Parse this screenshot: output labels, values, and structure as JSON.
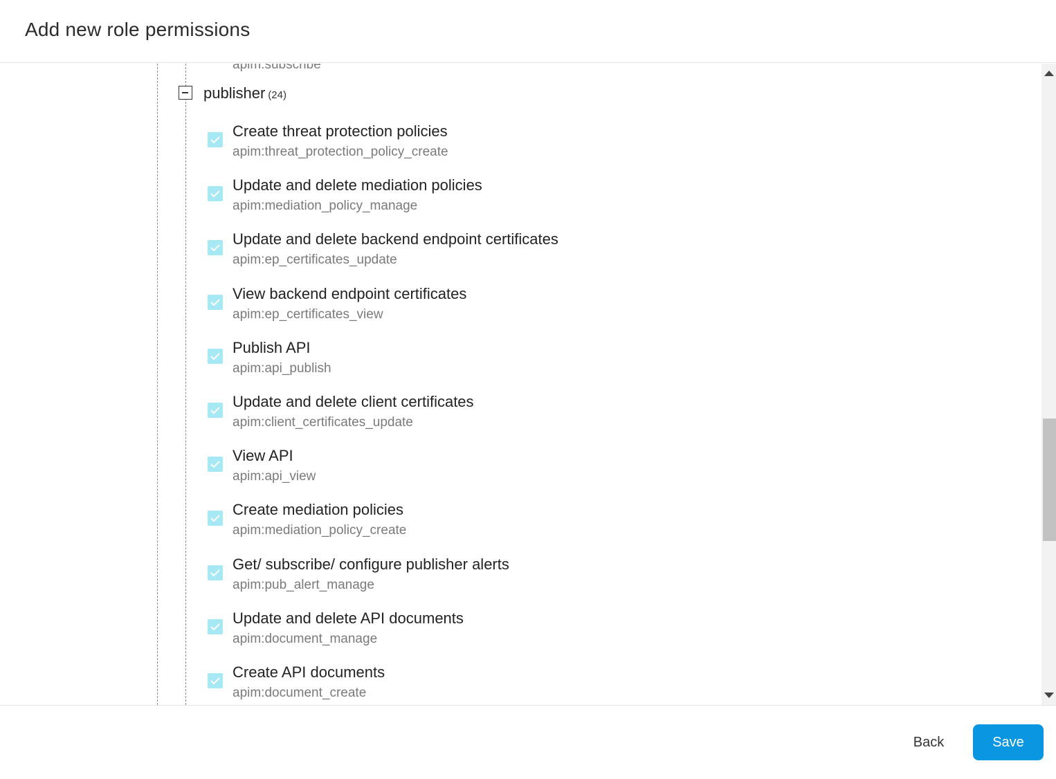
{
  "dialog": {
    "title": "Add new role permissions"
  },
  "tree": {
    "previous_item_code": "apim:subscribe",
    "group": {
      "name": "publisher",
      "count": "(24)",
      "expanded": true
    },
    "permissions": [
      {
        "label": "Create threat protection policies",
        "code": "apim:threat_protection_policy_create",
        "checked": true
      },
      {
        "label": "Update and delete mediation policies",
        "code": "apim:mediation_policy_manage",
        "checked": true
      },
      {
        "label": "Update and delete backend endpoint certificates",
        "code": "apim:ep_certificates_update",
        "checked": true
      },
      {
        "label": "View backend endpoint certificates",
        "code": "apim:ep_certificates_view",
        "checked": true
      },
      {
        "label": "Publish API",
        "code": "apim:api_publish",
        "checked": true
      },
      {
        "label": "Update and delete client certificates",
        "code": "apim:client_certificates_update",
        "checked": true
      },
      {
        "label": "View API",
        "code": "apim:api_view",
        "checked": true
      },
      {
        "label": "Create mediation policies",
        "code": "apim:mediation_policy_create",
        "checked": true
      },
      {
        "label": "Get/ subscribe/ configure publisher alerts",
        "code": "apim:pub_alert_manage",
        "checked": true
      },
      {
        "label": "Update and delete API documents",
        "code": "apim:document_manage",
        "checked": true
      },
      {
        "label": "Create API documents",
        "code": "apim:document_create",
        "checked": true
      }
    ]
  },
  "footer": {
    "back_label": "Back",
    "save_label": "Save"
  },
  "colors": {
    "accent": "#0a96e0",
    "checkbox_checked": "#a6e8f3"
  }
}
